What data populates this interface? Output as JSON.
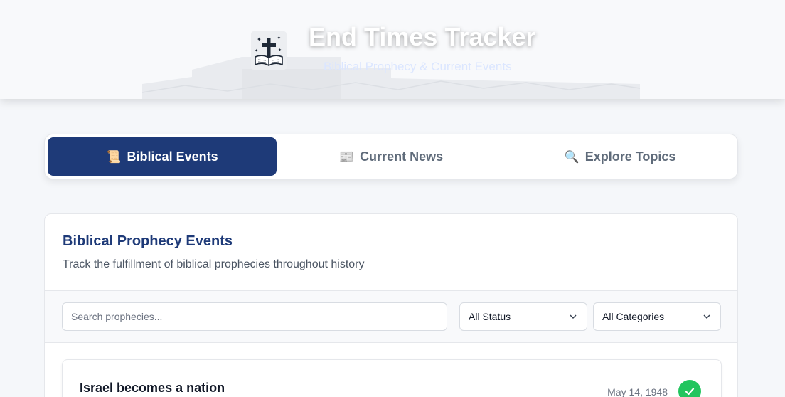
{
  "header": {
    "title": "End Times Tracker",
    "subtitle": "Biblical Prophecy & Current Events",
    "logo_icon": "bible-cross-icon"
  },
  "tabs": [
    {
      "label": "Biblical Events",
      "icon": "📜",
      "active": true
    },
    {
      "label": "Current News",
      "icon": "📰",
      "active": false
    },
    {
      "label": "Explore Topics",
      "icon": "🔍",
      "active": false
    }
  ],
  "section": {
    "title": "Biblical Prophecy Events",
    "description": "Track the fulfillment of biblical prophecies throughout history"
  },
  "filters": {
    "search_placeholder": "Search prophecies...",
    "status_value": "All Status",
    "category_value": "All Categories"
  },
  "events": [
    {
      "title": "Israel becomes a nation",
      "date": "May 14, 1948",
      "status_icon": "check-icon"
    }
  ],
  "colors": {
    "primary": "#1e3a78",
    "success": "#22c55e",
    "background": "#f5f7fa"
  }
}
